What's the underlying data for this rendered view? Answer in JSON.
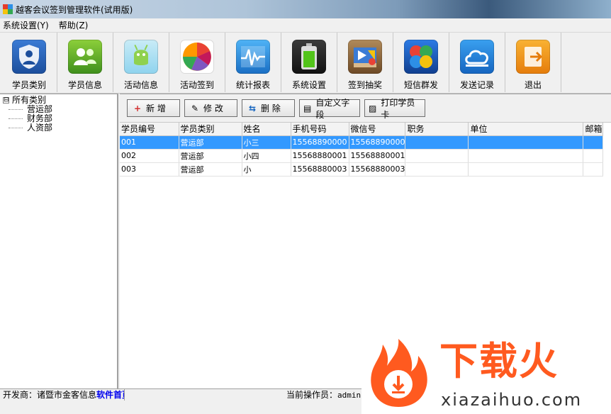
{
  "window": {
    "title": "越客会议签到管理软件(试用版)"
  },
  "menu": {
    "items": [
      "系统设置(Y)",
      "帮助(Z)"
    ]
  },
  "toolbar": {
    "items": [
      {
        "label": "学员类别",
        "icon": "shield-user-icon"
      },
      {
        "label": "学员信息",
        "icon": "users-icon"
      },
      {
        "label": "活动信息",
        "icon": "android-icon"
      },
      {
        "label": "活动签到",
        "icon": "colorful-fan-icon"
      },
      {
        "label": "统计报表",
        "icon": "chart-pulse-icon"
      },
      {
        "label": "系统设置",
        "icon": "battery-icon"
      },
      {
        "label": "签到抽奖",
        "icon": "media-box-icon"
      },
      {
        "label": "短信群发",
        "icon": "windows-logo-icon"
      },
      {
        "label": "发送记录",
        "icon": "cloud-icon"
      },
      {
        "label": "退出",
        "icon": "exit-icon"
      }
    ]
  },
  "tree": {
    "root": "所有类别",
    "toggle": "⊟",
    "children": [
      "营运部",
      "财务部",
      "人资部"
    ]
  },
  "actions": {
    "add": "新 增",
    "edit": "修 改",
    "delete": "删 除",
    "custom_field": "自定义字段",
    "print_card": "打印学员卡"
  },
  "table": {
    "columns": [
      "学员编号",
      "学员类别",
      "姓名",
      "手机号码",
      "微信号",
      "职务",
      "单位",
      "邮箱"
    ],
    "rows": [
      [
        "001",
        "营运部",
        "小三",
        "15568890000",
        "15568890000",
        "",
        "",
        ""
      ],
      [
        "002",
        "营运部",
        "小四",
        "15568880001",
        "15568880001",
        "",
        "",
        ""
      ],
      [
        "003",
        "营运部",
        "小",
        "15568880003",
        "15568880003",
        "",
        "",
        ""
      ]
    ],
    "selected_row": 0
  },
  "status": {
    "developer_label": "开发商：诸暨市金客信息",
    "developer_link": "软件首页",
    "operator_label": "当前操作员：",
    "operator_value": "admin"
  },
  "watermark": {
    "brand": "下载火",
    "site": "xiazaihuo.com"
  },
  "colors": {
    "selection": "#3399ff",
    "watermark": "#ff5a1f"
  }
}
